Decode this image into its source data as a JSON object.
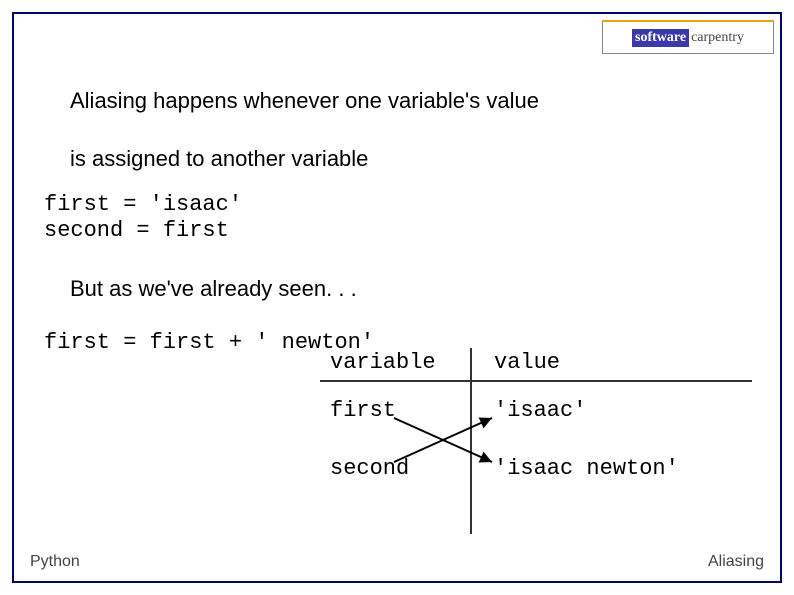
{
  "logo": {
    "software": "software",
    "carpentry": "carpentry"
  },
  "text": {
    "line1": "Aliasing happens whenever one variable's value",
    "line2": "is assigned to another variable",
    "seen": "But as we've already seen. . ."
  },
  "code": {
    "block1_line1": "first = 'isaac'",
    "block1_line2": "second = first",
    "block2_line1": "first = first + ' newton'"
  },
  "table": {
    "hdr_var": "variable",
    "hdr_val": "value",
    "r1_var": "first",
    "r1_val": "'isaac'",
    "r2_var": "second",
    "r2_val": "'isaac newton'"
  },
  "footer": {
    "left": "Python",
    "right": "Aliasing"
  }
}
